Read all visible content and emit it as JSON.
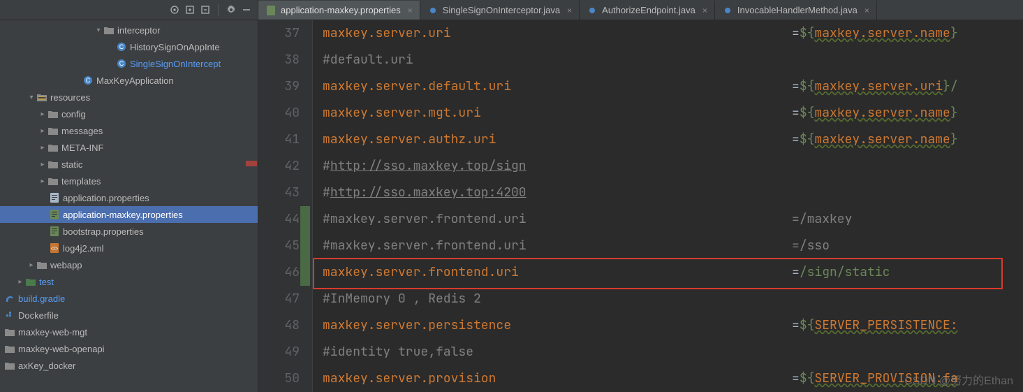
{
  "tree": {
    "interceptor": "interceptor",
    "history": "HistorySignOnAppInte",
    "single": "SingleSignOnIntercept",
    "maxkeyapp": "MaxKeyApplication",
    "resources": "resources",
    "config": "config",
    "messages": "messages",
    "metainf": "META-INF",
    "static": "static",
    "templates": "templates",
    "appprop": "application.properties",
    "appmax": "application-maxkey.properties",
    "bootstrap": "bootstrap.properties",
    "log4j": "log4j2.xml",
    "webapp": "webapp",
    "test": "test",
    "build": "build.gradle",
    "docker": "Dockerfile",
    "webmgt": "maxkey-web-mgt",
    "webopen": "maxkey-web-openapi",
    "dockerdir": "axKey_docker"
  },
  "tabs": {
    "t0": "application-maxkey.properties",
    "t1": "SingleSignOnInterceptor.java",
    "t2": "AuthorizeEndpoint.java",
    "t3": "InvocableHandlerMethod.java"
  },
  "gutter": [
    "37",
    "38",
    "39",
    "40",
    "41",
    "42",
    "43",
    "44",
    "45",
    "46",
    "47",
    "48",
    "49",
    "50"
  ],
  "code": {
    "l37": {
      "k": "maxkey.server.uri",
      "eq": "=",
      "d": "${",
      "v": "maxkey.server.name",
      "b": "}"
    },
    "l38": {
      "c": "#default.uri"
    },
    "l39": {
      "k": "maxkey.server.default.uri",
      "eq": "=",
      "d": "${",
      "v": "maxkey.server.uri",
      "b": "}/"
    },
    "l40": {
      "k": "maxkey.server.mgt.uri",
      "eq": "=",
      "d": "${",
      "v": "maxkey.server.name",
      "b": "}"
    },
    "l41": {
      "k": "maxkey.server.authz.uri",
      "eq": "=",
      "d": "${",
      "v": "maxkey.server.name",
      "b": "}"
    },
    "l42": {
      "h": "#",
      "u": "http://sso.maxkey.top/sign"
    },
    "l43": {
      "h": "#",
      "u": "http://sso.maxkey.top:4200"
    },
    "l44": {
      "c": "#maxkey.server.frontend.uri",
      "eq": "=",
      "s": "/maxkey"
    },
    "l45": {
      "c": "#maxkey.server.frontend.uri",
      "eq": "=",
      "s": "/sso"
    },
    "l46": {
      "k": "maxkey.server.frontend.uri",
      "eq": "=",
      "s": "/sign/static"
    },
    "l47": {
      "c": "#InMemory 0 , Redis 2"
    },
    "l48": {
      "k": "maxkey.server.persistence",
      "eq": "=",
      "d": "${",
      "v": "SERVER_PERSISTENCE:",
      "b": ""
    },
    "l49": {
      "c": "#identity true,false"
    },
    "l50": {
      "k": "maxkey.server.provision",
      "eq": "=",
      "d": "${",
      "v": "SERVER_PROVISION:fa",
      "b": ""
    }
  },
  "watermark": "CSDN @努力的Ethan"
}
